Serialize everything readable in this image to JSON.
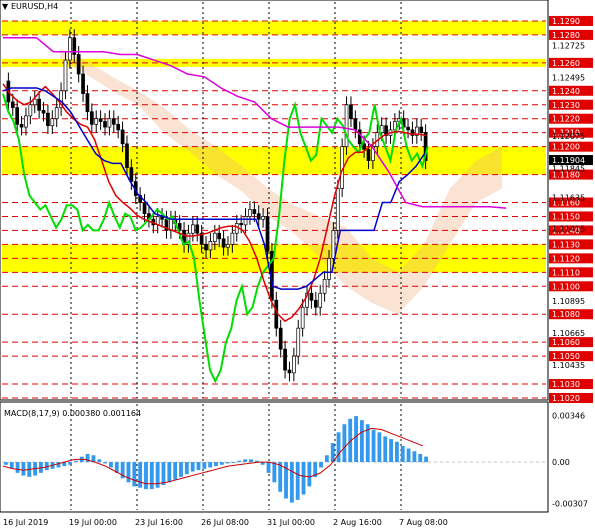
{
  "chart_data": [
    {
      "type": "candlestick",
      "title": "EURUSD,H4",
      "x_ticks": [
        "16 Jul 2019",
        "19 Jul 00:00",
        "23 Jul 16:00",
        "26 Jul 08:00",
        "31 Jul 00:00",
        "2 Aug 16:00",
        "7 Aug 08:00"
      ],
      "ylim": [
        1.102,
        1.13
      ],
      "y_ticks": [
        1.12725,
        1.12495,
        1.12075,
        1.11845,
        1.11635,
        1.11415,
        1.10895,
        1.10665,
        1.10435
      ],
      "levels": [
        1.129,
        1.128,
        1.126,
        1.124,
        1.123,
        1.122,
        1.121,
        1.12,
        1.118,
        1.116,
        1.115,
        1.114,
        1.113,
        1.112,
        1.111,
        1.11,
        1.108,
        1.106,
        1.105,
        1.103,
        1.102
      ],
      "current_price": 1.11904,
      "colors": {
        "levels": "#e00000",
        "zones": "#ffff00",
        "price_bg": "#000000",
        "ma_green": "#00dd00",
        "ma_red": "#e00000",
        "ma_blue": "#0000cc",
        "ma_magenta": "#dd00dd",
        "ichimoku_cloud": "#f0b080"
      },
      "close": [
        1.1247,
        1.1232,
        1.1228,
        1.1216,
        1.1214,
        1.1222,
        1.123,
        1.1234,
        1.1226,
        1.1224,
        1.1215,
        1.122,
        1.1228,
        1.124,
        1.1262,
        1.1278,
        1.1266,
        1.1252,
        1.1238,
        1.1225,
        1.1216,
        1.122,
        1.1218,
        1.1214,
        1.122,
        1.1216,
        1.1212,
        1.1202,
        1.1185,
        1.1175,
        1.1165,
        1.116,
        1.1152,
        1.1148,
        1.1144,
        1.115,
        1.1148,
        1.114,
        1.1148,
        1.1145,
        1.114,
        1.113,
        1.1138,
        1.1144,
        1.1138,
        1.113,
        1.1126,
        1.1132,
        1.1138,
        1.1134,
        1.1128,
        1.113,
        1.1138,
        1.1145,
        1.1144,
        1.115,
        1.1155,
        1.1152,
        1.1148,
        1.115,
        1.1125,
        1.109,
        1.107,
        1.1055,
        1.104,
        1.1038,
        1.105,
        1.107,
        1.1085,
        1.1095,
        1.109,
        1.1085,
        1.1095,
        1.1105,
        1.112,
        1.114,
        1.117,
        1.12,
        1.123,
        1.122,
        1.1212,
        1.1202,
        1.1198,
        1.119,
        1.12,
        1.121,
        1.1215,
        1.1208,
        1.1212,
        1.1218,
        1.122,
        1.1214,
        1.1212,
        1.1208,
        1.1214,
        1.121,
        1.119
      ],
      "series": [
        {
          "name": "",
          "color": "#00dd00",
          "values": [
            1.1238,
            1.1225,
            1.1218,
            1.1205,
            1.118,
            1.1165,
            1.116,
            1.1155,
            1.1158,
            1.115,
            1.1142,
            1.1148,
            1.1158,
            1.1158,
            1.1155,
            1.114,
            1.1144,
            1.114,
            1.114,
            1.1148,
            1.116,
            1.115,
            1.1142,
            1.1152,
            1.115,
            1.114,
            1.1142,
            1.1146,
            1.115,
            1.1155,
            1.1152,
            1.1148,
            1.115,
            1.114,
            1.113,
            1.1132,
            1.112,
            1.109,
            1.1065,
            1.104,
            1.1032,
            1.104,
            1.106,
            1.107,
            1.109,
            1.11,
            1.108,
            1.1085,
            1.11,
            1.111,
            1.1115,
            1.112,
            1.115,
            1.119,
            1.122,
            1.123,
            1.121,
            1.12,
            1.119,
            1.1194,
            1.122,
            1.1215,
            1.121,
            1.122,
            1.1215,
            1.1205,
            1.12,
            1.1196,
            1.1205,
            1.121,
            1.123,
            1.121,
            1.12,
            1.119,
            1.1212,
            1.122,
            1.12,
            1.119,
            1.1195,
            1.1186,
            1.12
          ]
        },
        {
          "name": "",
          "color": "#e00000",
          "values": [
            1.1245,
            1.1238,
            1.1233,
            1.123,
            1.1232,
            1.1238,
            1.1243,
            1.1238,
            1.1232,
            1.1225,
            1.122,
            1.1216,
            1.1214,
            1.1205,
            1.119,
            1.1175,
            1.1165,
            1.116,
            1.1156,
            1.1151,
            1.1148,
            1.1146,
            1.1144,
            1.1142,
            1.114,
            1.1138,
            1.1136,
            1.1136,
            1.1137,
            1.1138,
            1.114,
            1.1142,
            1.1143,
            1.1143,
            1.114,
            1.1132,
            1.112,
            1.1104,
            1.109,
            1.108,
            1.1075,
            1.1078,
            1.1084,
            1.1092,
            1.1104,
            1.112,
            1.1142,
            1.1164,
            1.1182,
            1.1192,
            1.1196,
            1.1196,
            1.12,
            1.1204,
            1.1208,
            1.121,
            1.1211,
            1.121,
            1.1209,
            1.1209,
            1.1208
          ]
        },
        {
          "name": "",
          "color": "#0000cc",
          "values": [
            1.124,
            1.1242,
            1.1242,
            1.1242,
            1.1242,
            1.124,
            1.1236,
            1.1232,
            1.1225,
            1.1215,
            1.1205,
            1.1195,
            1.119,
            1.1188,
            1.1188,
            1.1176,
            1.1166,
            1.116,
            1.1152,
            1.115,
            1.1148,
            1.1148,
            1.1148,
            1.1148,
            1.1148,
            1.1148,
            1.1148,
            1.1148,
            1.1148,
            1.1148,
            1.1148,
            1.113,
            1.11,
            1.1098,
            1.1098,
            1.1098,
            1.11,
            1.1105,
            1.111,
            1.111,
            1.114,
            1.114,
            1.114,
            1.114,
            1.114,
            1.116,
            1.116,
            1.1175,
            1.118,
            1.1186,
            1.1195
          ]
        },
        {
          "name": "",
          "color": "#dd00dd",
          "values": [
            1.1278,
            1.1278,
            1.1278,
            1.1268,
            1.1268,
            1.1268,
            1.1268,
            1.1266,
            1.1266,
            1.1262,
            1.1258,
            1.1252,
            1.125,
            1.1242,
            1.1236,
            1.1232,
            1.122,
            1.1214,
            1.1214,
            1.1214,
            1.1214,
            1.1212,
            1.12,
            1.1182,
            1.116,
            1.1157,
            1.1157,
            1.1157,
            1.1157,
            1.1157,
            1.1156
          ]
        }
      ]
    },
    {
      "type": "bar",
      "title": "MACD(8,17,9) 0.000380 0.001164",
      "ylim": [
        -0.0034,
        0.004
      ],
      "y_ticks": [
        0.00346,
        0.0,
        -0.00307
      ],
      "values": [
        -0.0002,
        -0.0005,
        -0.0008,
        -0.001,
        -0.0011,
        -0.001,
        -0.0008,
        -0.0006,
        -0.0005,
        -0.0004,
        -0.0003,
        -0.0002,
        0.0001,
        0.0004,
        0.0006,
        0.0005,
        0.0002,
        -0.0001,
        -0.0004,
        -0.0008,
        -0.0012,
        -0.0015,
        -0.0018,
        -0.0019,
        -0.002,
        -0.002,
        -0.0019,
        -0.0017,
        -0.0015,
        -0.0013,
        -0.0011,
        -0.0009,
        -0.0007,
        -0.0006,
        -0.0005,
        -0.0004,
        -0.0003,
        -0.0002,
        -0.0001,
        0.0,
        0.0001,
        0.0002,
        0.0002,
        0.0001,
        -0.0002,
        -0.0008,
        -0.0015,
        -0.0022,
        -0.0027,
        -0.003,
        -0.0028,
        -0.0024,
        -0.0018,
        -0.0011,
        -0.0004,
        0.0005,
        0.0014,
        0.0022,
        0.0028,
        0.0032,
        0.0034,
        0.0031,
        0.0028,
        0.0024,
        0.0022,
        0.0019,
        0.0017,
        0.0015,
        0.0012,
        0.001,
        0.0008,
        0.0006,
        0.0004
      ],
      "signal": [
        -0.0003,
        -0.0005,
        -0.0006,
        -0.0005,
        -0.0004,
        -0.0002,
        0.0,
        0.0002,
        0.0002,
        0.0,
        -0.0003,
        -0.0007,
        -0.0011,
        -0.0014,
        -0.0016,
        -0.0016,
        -0.0015,
        -0.0013,
        -0.0011,
        -0.0009,
        -0.0007,
        -0.0005,
        -0.0003,
        -0.0002,
        -0.0001,
        0.0,
        0.0,
        -0.0002,
        -0.0006,
        -0.001,
        -0.0011,
        -0.0008,
        -0.0002,
        0.0008,
        0.0016,
        0.0022,
        0.0025,
        0.0024,
        0.0021,
        0.0018,
        0.0015,
        0.0012
      ]
    }
  ]
}
